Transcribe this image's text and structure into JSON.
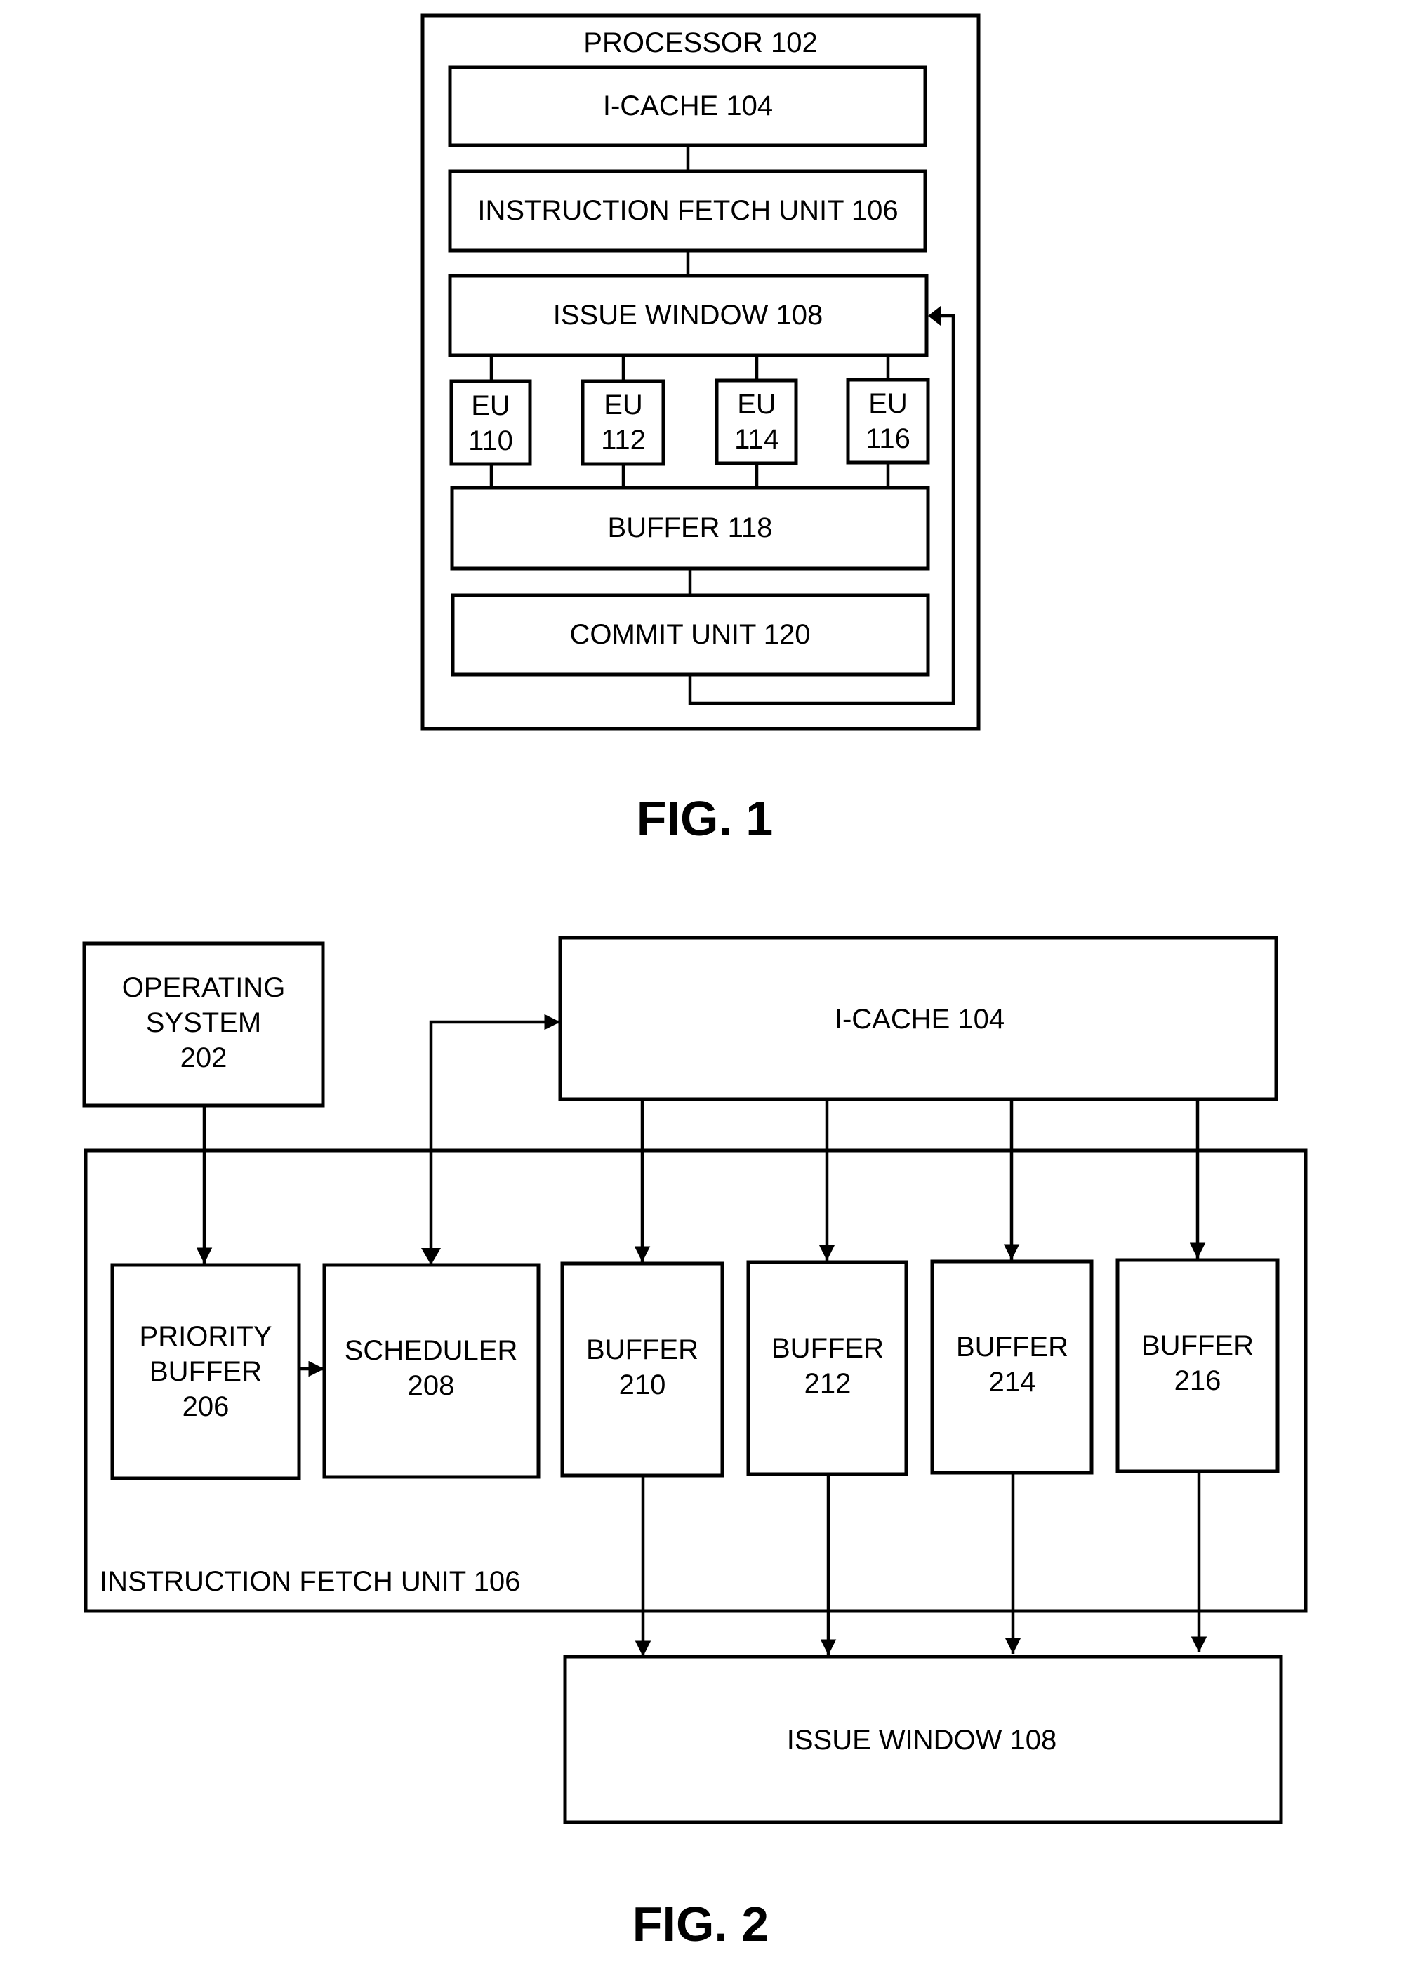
{
  "fig1": {
    "caption": "FIG. 1",
    "processor": "PROCESSOR 102",
    "icache": "I-CACHE 104",
    "ifu": "INSTRUCTION FETCH UNIT 106",
    "issue_window": "ISSUE WINDOW 108",
    "execution_units": [
      {
        "line1": "EU",
        "line2": "110"
      },
      {
        "line1": "EU",
        "line2": "112"
      },
      {
        "line1": "EU",
        "line2": "114"
      },
      {
        "line1": "EU",
        "line2": "116"
      }
    ],
    "buffer": "BUFFER 118",
    "commit": "COMMIT UNIT 120"
  },
  "fig2": {
    "caption": "FIG. 2",
    "os": {
      "line1": "OPERATING",
      "line2": "SYSTEM",
      "line3": "202"
    },
    "icache": "I-CACHE 104",
    "ifu_label": "INSTRUCTION FETCH UNIT 106",
    "priority_buffer": {
      "line1": "PRIORITY",
      "line2": "BUFFER",
      "line3": "206"
    },
    "scheduler": {
      "line1": "SCHEDULER",
      "line2": "208"
    },
    "buffers": [
      {
        "line1": "BUFFER",
        "line2": "210"
      },
      {
        "line1": "BUFFER",
        "line2": "212"
      },
      {
        "line1": "BUFFER",
        "line2": "214"
      },
      {
        "line1": "BUFFER",
        "line2": "216"
      }
    ],
    "issue_window": "ISSUE WINDOW 108"
  }
}
